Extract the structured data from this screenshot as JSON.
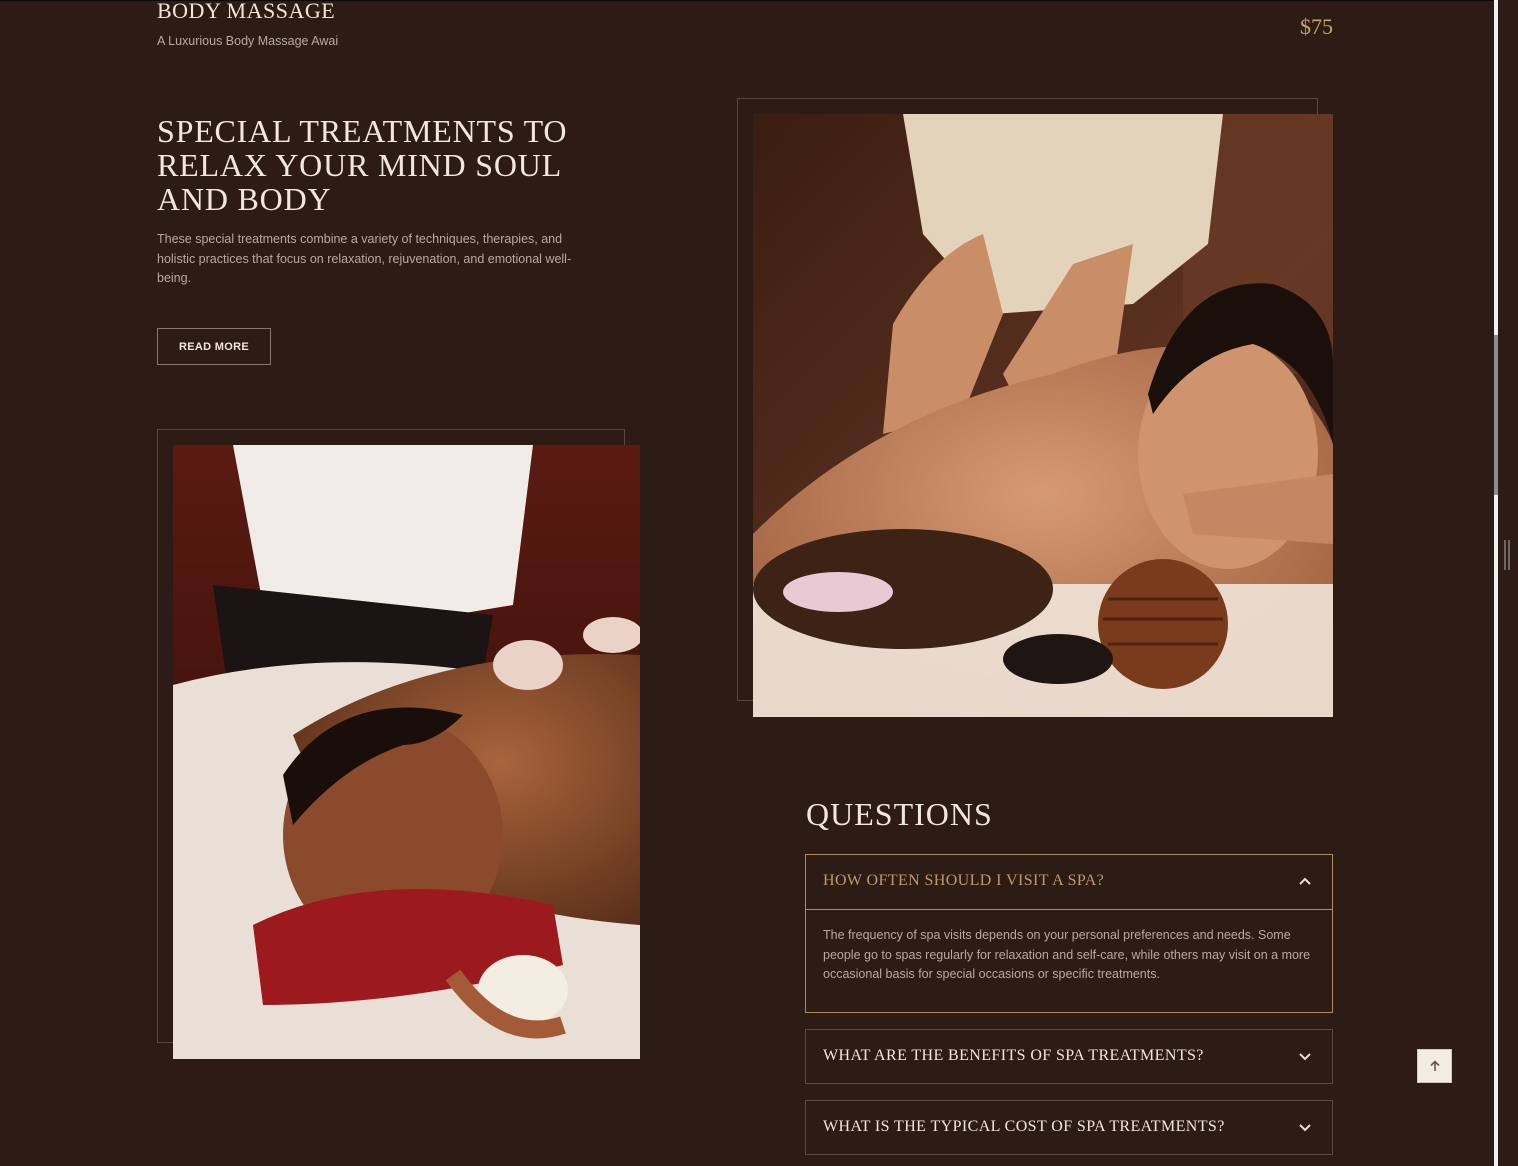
{
  "service": {
    "title": "BODY MASSAGE",
    "subtitle": "A Luxurious Body Massage Awai",
    "price": "$75"
  },
  "hero": {
    "title": "SPECIAL TREATMENTS TO RELAX YOUR MIND SOUL AND BODY",
    "text": "These special treatments combine a variety of techniques, therapies, and holistic practices that focus on relaxation, rejuvenation, and emotional well-being.",
    "button_label": "READ MORE"
  },
  "images": [
    {
      "icon": "massage-photo-back-massage"
    },
    {
      "icon": "massage-photo-stone-therapy"
    }
  ],
  "faq": {
    "title": "QUESTIONS",
    "items": [
      {
        "question": "HOW OFTEN SHOULD I VISIT A SPA?",
        "answer": "The frequency of spa visits depends on your personal preferences and needs. Some people go to spas regularly for relaxation and self-care, while others may visit on a more occasional basis for special occasions or specific treatments.",
        "expanded": true,
        "icon": "chevron-up-icon"
      },
      {
        "question": "WHAT ARE THE BENEFITS OF SPA TREATMENTS?",
        "expanded": false,
        "icon": "chevron-down-icon"
      },
      {
        "question": "WHAT IS THE TYPICAL COST OF SPA TREATMENTS?",
        "expanded": false,
        "icon": "chevron-down-icon"
      }
    ]
  },
  "scroll_top": {
    "icon": "arrow-up-icon"
  },
  "colors": {
    "background": "#2d1b15",
    "accent": "#c29a62",
    "heading": "#f1e8dc",
    "body_text": "#b8aaa0"
  }
}
